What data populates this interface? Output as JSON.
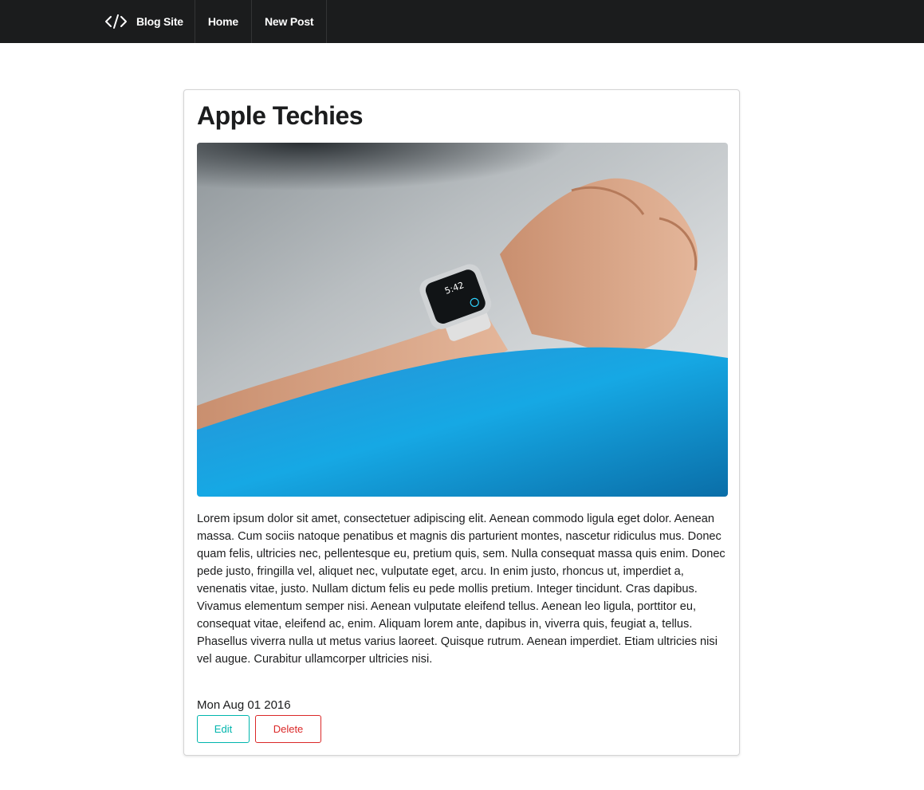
{
  "nav": {
    "brand_icon": "code-icon",
    "brand_label": "Blog Site",
    "items": [
      {
        "label": "Home"
      },
      {
        "label": "New Post"
      }
    ]
  },
  "post": {
    "title": "Apple Techies",
    "image_subject": "smartwatch-on-wrist",
    "watch_time": "5:42",
    "body": "Lorem ipsum dolor sit amet, consectetuer adipiscing elit. Aenean commodo ligula eget dolor. Aenean massa. Cum sociis natoque penatibus et magnis dis parturient montes, nascetur ridiculus mus. Donec quam felis, ultricies nec, pellentesque eu, pretium quis, sem. Nulla consequat massa quis enim. Donec pede justo, fringilla vel, aliquet nec, vulputate eget, arcu. In enim justo, rhoncus ut, imperdiet a, venenatis vitae, justo. Nullam dictum felis eu pede mollis pretium. Integer tincidunt. Cras dapibus. Vivamus elementum semper nisi. Aenean vulputate eleifend tellus. Aenean leo ligula, porttitor eu, consequat vitae, eleifend ac, enim. Aliquam lorem ante, dapibus in, viverra quis, feugiat a, tellus. Phasellus viverra nulla ut metus varius laoreet. Quisque rutrum. Aenean imperdiet. Etiam ultricies nisi vel augue. Curabitur ullamcorper ultricies nisi.",
    "date": "Mon Aug 01 2016",
    "edit_label": "Edit",
    "delete_label": "Delete"
  },
  "colors": {
    "navbar_bg": "#1b1c1d",
    "edit_teal": "#00b5ad",
    "delete_red": "#db2828",
    "sleeve_blue": "#1a9fe0"
  }
}
